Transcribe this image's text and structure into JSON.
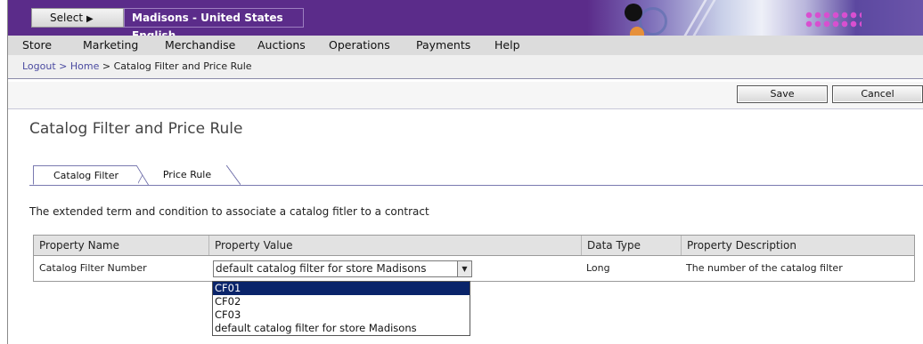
{
  "header": {
    "select_label": "Select",
    "store_title": "Madisons - United States English"
  },
  "menu": {
    "items": [
      {
        "label": "Store"
      },
      {
        "label": "Marketing"
      },
      {
        "label": "Merchandise"
      },
      {
        "label": "Auctions"
      },
      {
        "label": "Operations"
      },
      {
        "label": "Payments"
      },
      {
        "label": "Help"
      }
    ]
  },
  "breadcrumb": {
    "items": [
      {
        "label": "Logout"
      },
      {
        "label": "Home"
      },
      {
        "label": "Catalog Filter and Price Rule"
      }
    ],
    "separator": ">"
  },
  "actions": {
    "save": "Save",
    "cancel": "Cancel"
  },
  "page": {
    "title": "Catalog Filter and Price Rule",
    "tabs": [
      {
        "label": "Catalog Filter",
        "active": true
      },
      {
        "label": "Price Rule",
        "active": false
      }
    ],
    "description": "The extended term and condition to associate a catalog fitler to a contract"
  },
  "table": {
    "columns": [
      "Property Name",
      "Property Value",
      "Data Type",
      "Property Description"
    ],
    "rows": [
      {
        "name": "Catalog Filter Number",
        "value": "default catalog filter for store Madisons",
        "type": "Long",
        "description": "The number of the catalog filter"
      }
    ]
  },
  "dropdown": {
    "options": [
      "CF01",
      "CF02",
      "CF03",
      "default catalog filter for store Madisons"
    ],
    "highlighted": "CF01"
  },
  "colors": {
    "header_purple": "#5b2c8a",
    "menu_bg": "#dcdcdc",
    "selection_blue": "#0a246a",
    "link_color": "#4a4aa0"
  }
}
